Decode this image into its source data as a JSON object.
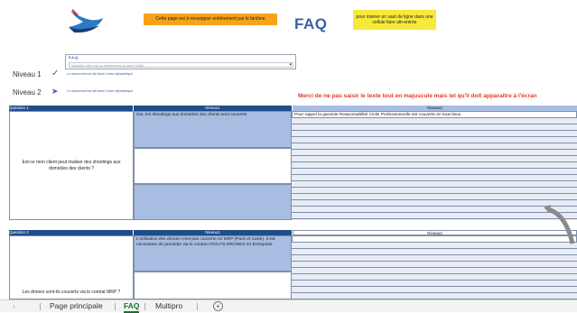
{
  "header": {
    "orange_note": "Cette page est à renseigner entièrement par le binôme",
    "title": "FAQ",
    "yellow_note": "pour insérer un saut de ligne dans une cellule faire alt+entrée"
  },
  "search": {
    "label": "F.A.Q.",
    "placeholder": "Saisissez votre mot ou sélectionnez-le parmi la liste..."
  },
  "levels": {
    "level1_label": "Niveau 1",
    "level2_label": "Niveau 2",
    "level1_hint": "Le classement se fait dans l'ordre alphabétique",
    "level2_hint": "Le classement se fait dans l'ordre alphabétique"
  },
  "warning": "Merci de ne pas saisir le texte tout en majuscule mais tel qu'il doit apparaître à l'écran",
  "questions": [
    {
      "header": "Question 1",
      "level1_header": "Niveau1",
      "level2_header": "Niveau2",
      "question": "Est-ce mon client peut réaliser des shootings aux domiciles des clients ?",
      "answer_level1": "Oui, les shootings aux domiciles des clients sont couverts",
      "answer_level2": "Pour rappel la garantie Responsabilité Civile Professionnelle est couverte en tous lieux."
    },
    {
      "header": "Question 2",
      "level1_header": "Niveau1",
      "level2_header": "Niveau2",
      "question": "Les drones sont-ils couverts via le contrat MRP ?",
      "answer_level1": "L'utilisation des drones n'est pas couverte en MRP (Pack et Carte). Il est nécessaire de procéder via le contrat ATOUTS DRONES en Entreprise.",
      "answer_level2": ""
    }
  ],
  "sheet_tabs": {
    "tab1": "Page principale",
    "tab2": "FAQ",
    "tab3": "Multipro",
    "add": "+"
  },
  "colors": {
    "header_blue": "#1f4d8a",
    "cell_blue": "#a7bde2",
    "warning_red": "#e23a2a",
    "accent": "#3b5fab"
  }
}
